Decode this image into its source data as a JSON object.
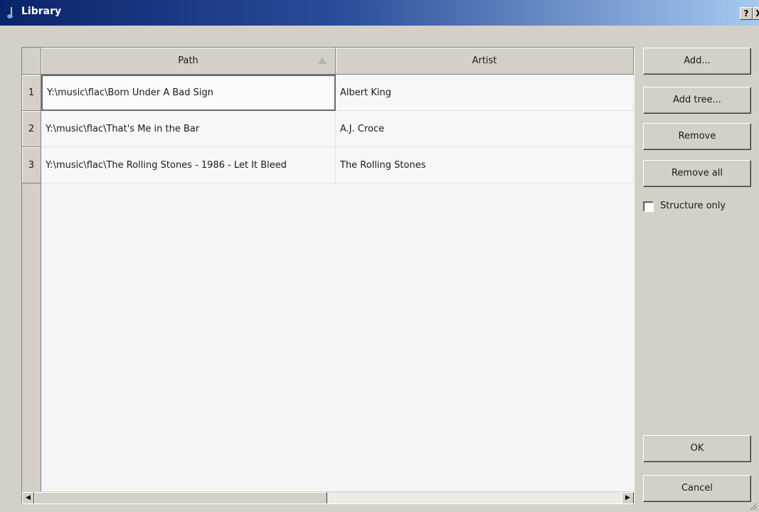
{
  "window": {
    "title": "Library",
    "help_label": "?",
    "close_label": "X"
  },
  "table": {
    "columns": [
      "Path",
      "Artist"
    ],
    "sort_column": "Path",
    "rows": [
      {
        "index": "1",
        "path": "Y:\\music\\flac\\Born Under A Bad Sign",
        "artist": "Albert King"
      },
      {
        "index": "2",
        "path": "Y:\\music\\flac\\That's Me in the Bar",
        "artist": "A.J. Croce"
      },
      {
        "index": "3",
        "path": "Y:\\music\\flac\\The Rolling Stones - 1986 - Let It Bleed",
        "artist": "The Rolling Stones"
      }
    ],
    "current_cell": "row 1, Path"
  },
  "buttons": {
    "add": "Add...",
    "add_tree": "Add tree...",
    "remove": "Remove",
    "remove_all": "Remove all",
    "ok": "OK",
    "cancel": "Cancel"
  },
  "options": {
    "structure_only_label": "Structure only",
    "structure_only_checked": false
  },
  "scrollbar": {
    "left_icon": "◀",
    "right_icon": "▶"
  },
  "colors": {
    "title_start": "#0a246a",
    "title_end": "#a6caf0",
    "dialog_bg": "#d4d0c8",
    "grid_bg": "#f5f5f5"
  },
  "icons": [
    "app-icon",
    "sort-ascending-icon",
    "scroll-left-icon",
    "scroll-right-icon",
    "resize-grip-icon"
  ]
}
